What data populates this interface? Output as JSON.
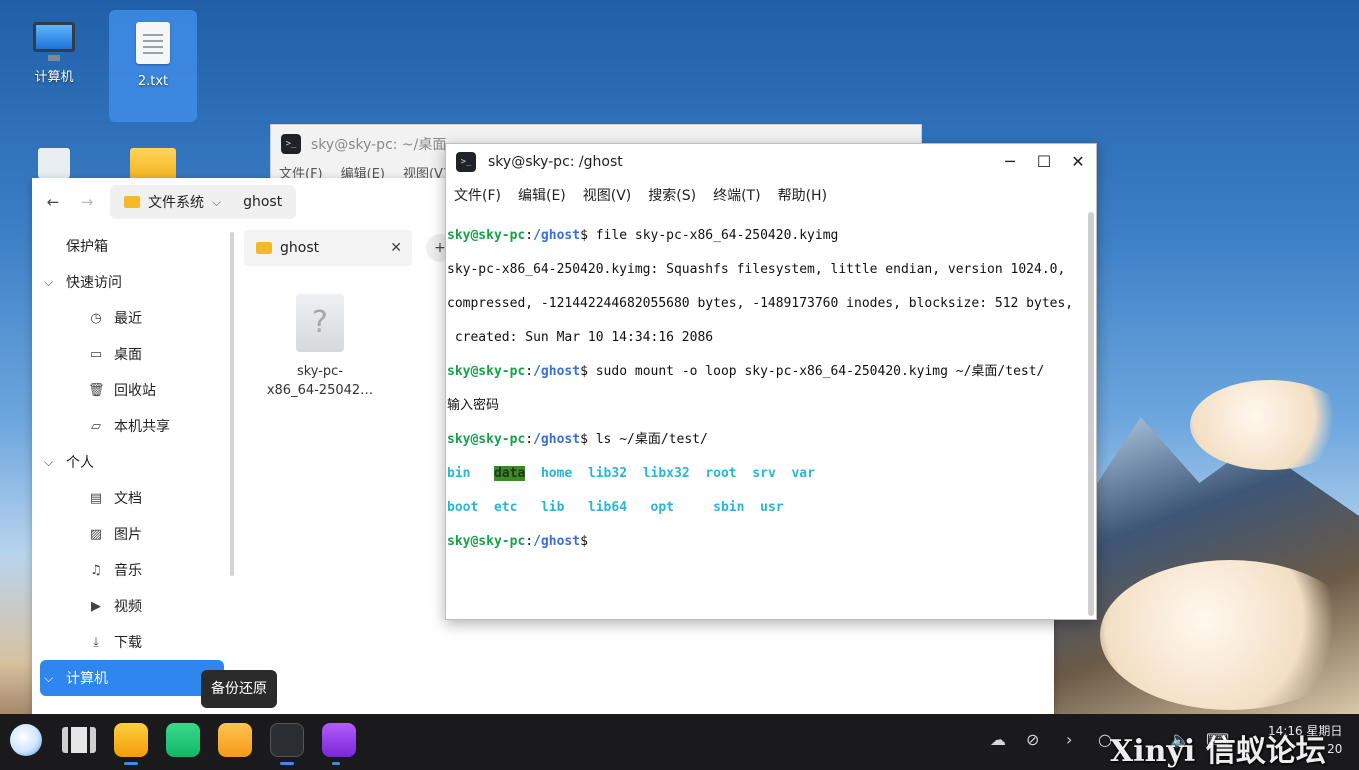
{
  "desktop": {
    "icons": [
      {
        "label": "计算机",
        "icon": "computer-icon"
      },
      {
        "label": "2.txt",
        "icon": "text-file-icon"
      },
      {
        "label": "",
        "icon": "trash-icon"
      },
      {
        "label": "",
        "icon": "folder-icon"
      }
    ]
  },
  "term_back": {
    "title": "sky@sky-pc: ~/桌面",
    "menu": [
      "文件(F)",
      "编辑(E)",
      "视图(V)"
    ]
  },
  "file_manager": {
    "breadcrumb": [
      "文件系统",
      "ghost"
    ],
    "tab_label": "ghost",
    "sidebar": {
      "vault": "保护箱",
      "quick_access": "快速访问",
      "quick_items": [
        "最近",
        "桌面",
        "回收站",
        "本机共享"
      ],
      "personal": "个人",
      "personal_items": [
        "文档",
        "图片",
        "音乐",
        "视频",
        "下载"
      ],
      "computer": "计算机"
    },
    "file": {
      "name_line1": "sky-pc-",
      "name_line2": "x86_64-25042…",
      "glyph": "?"
    }
  },
  "tooltip": "备份还原",
  "terminal": {
    "title": "sky@sky-pc: /ghost",
    "menu": [
      "文件(F)",
      "编辑(E)",
      "视图(V)",
      "搜索(S)",
      "终端(T)",
      "帮助(H)"
    ],
    "prompt_user": "sky@sky-pc",
    "prompt_path": "/ghost",
    "lines": {
      "cmd1": "$ file sky-pc-x86_64-250420.kyimg",
      "out1": "sky-pc-x86_64-250420.kyimg: Squashfs filesystem, little endian, version 1024.0,",
      "out2": "compressed, -121442244682055680 bytes, -1489173760 inodes, blocksize: 512 bytes,",
      "out3": " created: Sun Mar 10 14:34:16 2086",
      "cmd2": "$ sudo mount -o loop sky-pc-x86_64-250420.kyimg ~/桌面/test/",
      "out4": "输入密码",
      "cmd3": "$ ls ~/桌面/test/",
      "end": "$"
    },
    "ls_row1": [
      "bin",
      "data",
      "home",
      "lib32",
      "libx32",
      "root",
      "srv",
      "var"
    ],
    "ls_row2": [
      "boot",
      "etc",
      "lib",
      "lib64",
      "opt",
      "sbin",
      "usr"
    ]
  },
  "taskbar": {
    "clock_time": "14:16 星期日",
    "clock_date": "20",
    "watermark": "Xinyi 信蚁论坛"
  },
  "colors": {
    "accent": "#2f86ee",
    "prompt_user": "#17a24a",
    "prompt_path": "#3a6fd8",
    "dir": "#2ab5d4"
  }
}
